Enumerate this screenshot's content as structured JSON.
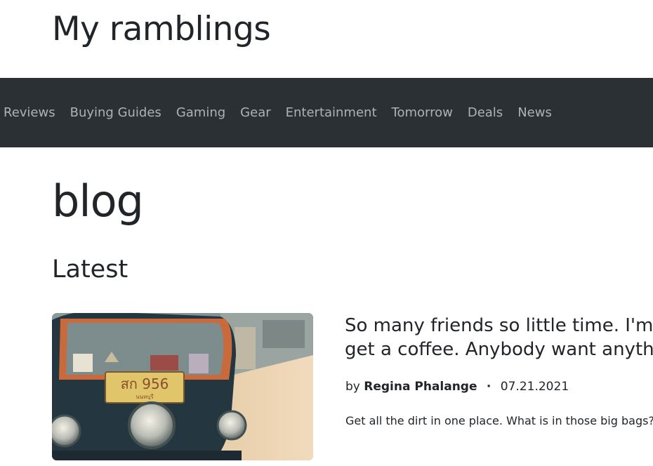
{
  "site": {
    "title": "My ramblings"
  },
  "nav": {
    "items": [
      {
        "label": "Reviews"
      },
      {
        "label": "Buying Guides"
      },
      {
        "label": "Gaming"
      },
      {
        "label": "Gear"
      },
      {
        "label": "Entertainment"
      },
      {
        "label": "Tomorrow"
      },
      {
        "label": "Deals"
      },
      {
        "label": "News"
      }
    ]
  },
  "page": {
    "heading": "blog",
    "section_heading": "Latest"
  },
  "post": {
    "title": "So many friends so little time. I'm going to\nget a coffee. Anybody want anything?",
    "by_label": "by",
    "author": "Regina Phalange",
    "separator": "·",
    "date": "07.21.2021",
    "excerpt": "Get all the dirt in one place. What is in those big bags?",
    "image": {
      "license_plate": "สก 956",
      "plate_subtitle": "นนทบุรี"
    }
  },
  "colors": {
    "navbar_bg": "#2b3035",
    "text": "#212529",
    "nav_text": "rgba(255,255,255,0.62)"
  }
}
